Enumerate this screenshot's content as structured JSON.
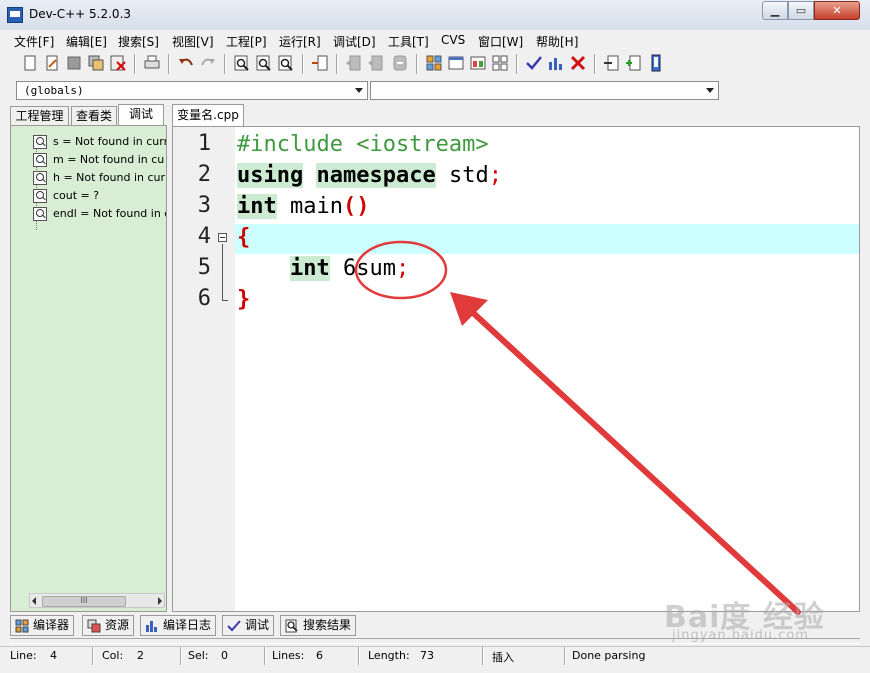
{
  "window": {
    "title": "Dev-C++ 5.2.0.3"
  },
  "menu": [
    "文件[F]",
    "编辑[E]",
    "搜索[S]",
    "视图[V]",
    "工程[P]",
    "运行[R]",
    "调试[D]",
    "工具[T]",
    "CVS",
    "窗口[W]",
    "帮助[H]"
  ],
  "toolbar": {
    "icons": [
      "new-file-icon",
      "open-file-icon",
      "save-icon",
      "save-all-icon",
      "close-file-icon",
      "print-icon",
      "undo-icon",
      "redo-icon",
      "find-icon",
      "find-next-icon",
      "replace-icon",
      "goto-line-icon",
      "bookmark-prev-icon",
      "bookmark-next-icon",
      "toggle-comment-icon",
      "new-project-icon",
      "project-options-icon",
      "class-browser-icon",
      "grid-icon",
      "check-syntax-icon",
      "profile-chart-icon",
      "delete-icon",
      "import-icon",
      "add-to-project-icon",
      "file-properties-icon"
    ]
  },
  "combos": {
    "globals_value": "(globals)",
    "members_value": ""
  },
  "left_panel": {
    "tabs": [
      "工程管理",
      "查看类",
      "调试"
    ],
    "active_tab": "调试",
    "watches": [
      "s = Not found in curr",
      "m = Not found in cu",
      "h = Not found in cur",
      "cout = ?",
      "endl = Not found in c"
    ],
    "scroll_thumb": "III"
  },
  "editor": {
    "tab_label": "变量名.cpp",
    "line_numbers": [
      "1",
      "2",
      "3",
      "4",
      "5",
      "6"
    ],
    "lines": {
      "l1": {
        "text": "#include <iostream>"
      },
      "l2": {
        "kw1": "using",
        "kw2": "namespace",
        "rest": " std",
        "semi": ";"
      },
      "l3": {
        "kw": "int",
        "name": " main",
        "parens": "()"
      },
      "l4": {
        "brace": "{"
      },
      "l5": {
        "indent": "    ",
        "kw": "int",
        "ident": " 6sum",
        "semi": ";"
      },
      "l6": {
        "brace": "}"
      }
    },
    "active_line": 4,
    "annotation_color": "#e03a3a"
  },
  "bottom_tabs": [
    {
      "label": "编译器",
      "icon": "compiler-grid-icon"
    },
    {
      "label": "资源",
      "icon": "resources-icon"
    },
    {
      "label": "编译日志",
      "icon": "compile-log-chart-icon"
    },
    {
      "label": "调试",
      "icon": "debug-check-icon"
    },
    {
      "label": "搜索结果",
      "icon": "search-results-icon"
    }
  ],
  "status": {
    "line_label": "Line:",
    "line_value": "4",
    "col_label": "Col:",
    "col_value": "2",
    "sel_label": "Sel:",
    "sel_value": "0",
    "lines_label": "Lines:",
    "lines_value": "6",
    "length_label": "Length:",
    "length_value": "73",
    "mode": "插入",
    "message": "Done parsing"
  },
  "watermark": {
    "logo": "Bai度 经验",
    "url": "jingyan.baidu.com"
  }
}
